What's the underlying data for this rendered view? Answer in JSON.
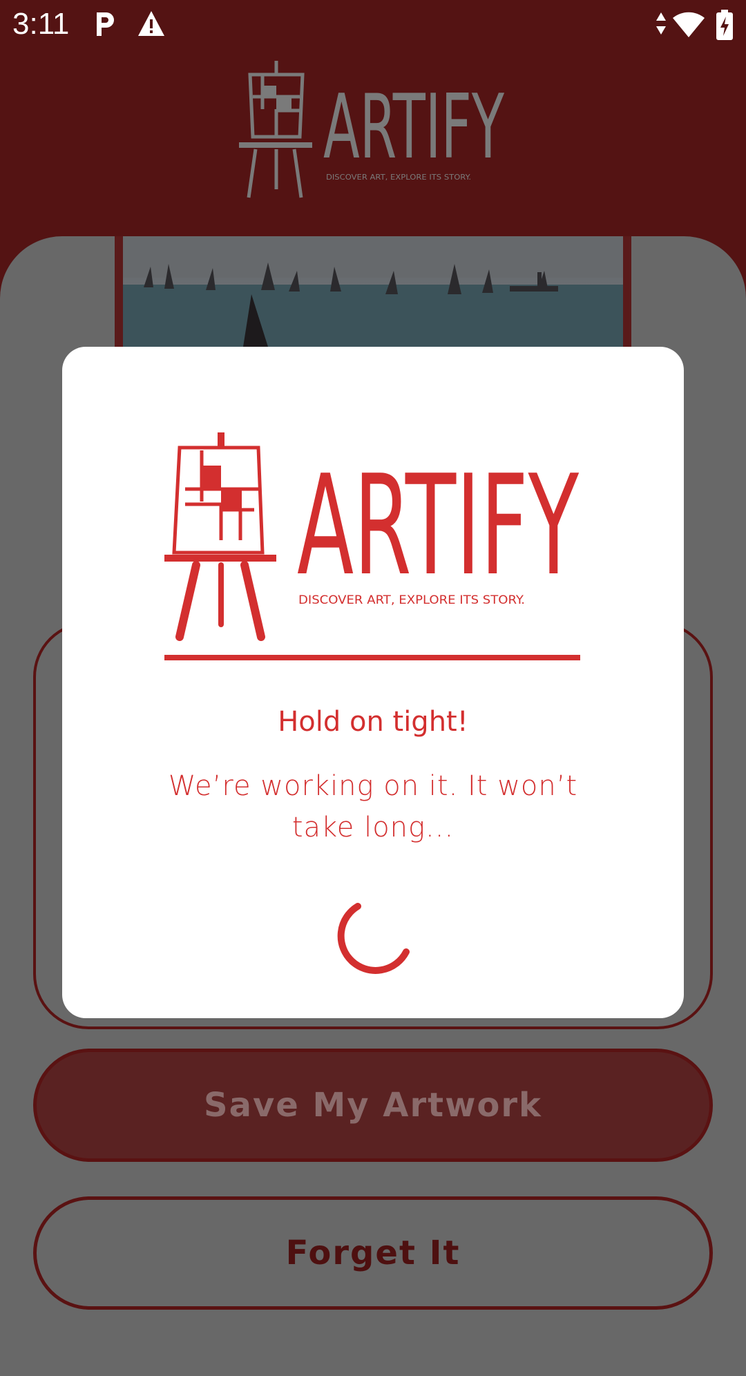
{
  "status_bar": {
    "time": "3:11",
    "icons": [
      "parking-icon",
      "warning-icon",
      "data-arrows-icon",
      "wifi-icon",
      "battery-charging-icon"
    ]
  },
  "app": {
    "logo": {
      "name": "ARTIFY",
      "tagline": "DISCOVER ART, EXPLORE ITS STORY."
    },
    "buttons": {
      "save": "Save My Artwork",
      "forget": "Forget It"
    }
  },
  "dialog": {
    "logo": {
      "name": "ARTIFY",
      "tagline": "DISCOVER ART, EXPLORE ITS STORY."
    },
    "title": "Hold on tight!",
    "message": "We’re working on it. It won’t take long...",
    "spinner": "loading-spinner-icon"
  },
  "colors": {
    "brand_red": "#d32f2f",
    "header_dimmed": "#541313",
    "overlay_gray": "#686868",
    "dialog_bg": "#ffffff"
  }
}
